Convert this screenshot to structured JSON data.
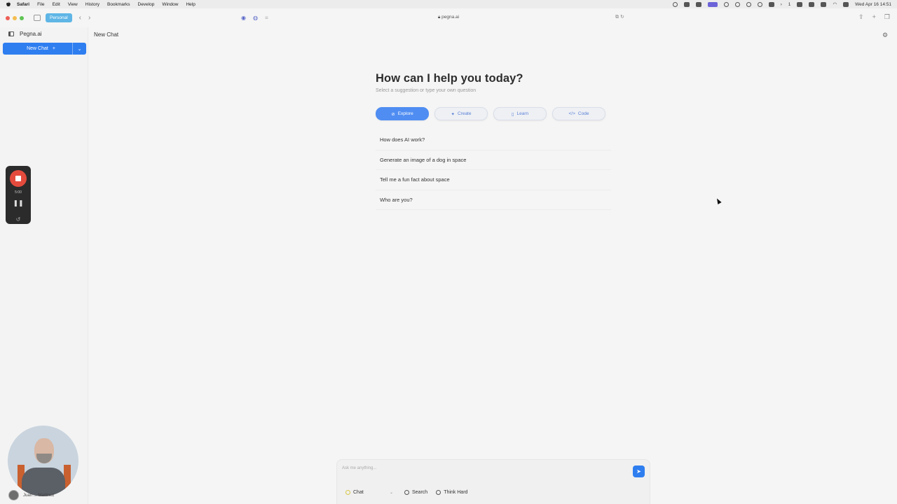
{
  "menubar": {
    "items": [
      "Safari",
      "File",
      "Edit",
      "View",
      "History",
      "Bookmarks",
      "Develop",
      "Window",
      "Help"
    ],
    "status_number": "1",
    "clock": "Wed Apr 16  14:51"
  },
  "browser": {
    "profile": "Personal",
    "url": "pegna.ai"
  },
  "sidebar": {
    "brand": "Pegna.ai",
    "new_chat_label": "New Chat",
    "new_chat_plus": "+"
  },
  "recorder": {
    "time": "5:00"
  },
  "main": {
    "title": "New Chat",
    "heading": "How can I help you today?",
    "subheading": "Select a suggestion or type your own question",
    "tabs": [
      {
        "label": "Explore",
        "icon": "compass-icon",
        "active": true
      },
      {
        "label": "Create",
        "icon": "sparkle-icon",
        "active": false
      },
      {
        "label": "Learn",
        "icon": "book-icon",
        "active": false
      },
      {
        "label": "Code",
        "icon": "code-icon",
        "active": false
      }
    ],
    "suggestions": [
      "How does AI work?",
      "Generate an image of a dog in space",
      "Tell me a fun fact about space",
      "Who are you?"
    ]
  },
  "composer": {
    "placeholder": "Ask me anything...",
    "mode": "Chat",
    "search": "Search",
    "think": "Think Hard"
  },
  "presenter": {
    "name": "Juan ... Martinez"
  },
  "colors": {
    "accent": "#2f7ef0",
    "tab_active": "#4f8df2",
    "profile_badge": "#5fb6e6",
    "recorder_stop": "#e44b3d"
  }
}
